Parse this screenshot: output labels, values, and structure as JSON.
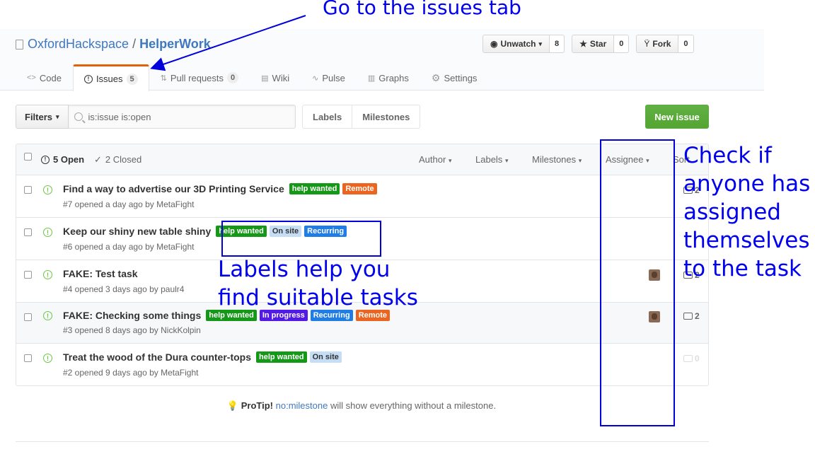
{
  "annotations": {
    "issues_tab": "Go to the issues tab",
    "labels_line1": "Labels help you",
    "labels_line2": "find suitable tasks",
    "assignee_line1": "Check if",
    "assignee_line2": "anyone has",
    "assignee_line3": "assigned",
    "assignee_line4": "themselves",
    "assignee_line5": "to the task"
  },
  "repo": {
    "owner": "OxfordHackspace",
    "separator": "/",
    "name": "HelperWork"
  },
  "actions": {
    "unwatch_label": "Unwatch",
    "unwatch_count": "8",
    "star_label": "Star",
    "star_count": "0",
    "fork_label": "Fork",
    "fork_count": "0"
  },
  "nav": {
    "code": "Code",
    "issues": "Issues",
    "issues_count": "5",
    "pulls": "Pull requests",
    "pulls_count": "0",
    "wiki": "Wiki",
    "pulse": "Pulse",
    "graphs": "Graphs",
    "settings": "Settings"
  },
  "filters": {
    "button": "Filters",
    "query": "is:issue is:open"
  },
  "subnav": {
    "labels": "Labels",
    "milestones": "Milestones"
  },
  "new_issue": "New issue",
  "table_header": {
    "open": "5 Open",
    "closed": "2 Closed",
    "author": "Author",
    "labels": "Labels",
    "milestones": "Milestones",
    "assignee": "Assignee",
    "sort": "Sort"
  },
  "issues": [
    {
      "title": "Find a way to advertise our 3D Printing Service",
      "meta": "#7 opened a day ago by MetaFight",
      "labels": [
        "help wanted",
        "Remote"
      ],
      "comments": "2"
    },
    {
      "title": "Keep our shiny new table shiny",
      "meta": "#6 opened a day ago by MetaFight",
      "labels": [
        "help wanted",
        "On site",
        "Recurring"
      ],
      "comments": ""
    },
    {
      "title": "FAKE: Test task",
      "meta": "#4 opened 3 days ago by paulr4",
      "labels": [],
      "comments": "2"
    },
    {
      "title": "FAKE: Checking some things",
      "meta": "#3 opened 8 days ago by NickKolpin",
      "labels": [
        "help wanted",
        "In progress",
        "Recurring",
        "Remote"
      ],
      "comments": "2"
    },
    {
      "title": "Treat the wood of the Dura counter-tops",
      "meta": "#2 opened 9 days ago by MetaFight",
      "labels": [
        "help wanted",
        "On site"
      ],
      "comments": "0"
    }
  ],
  "label_colors": {
    "help wanted": "#159818",
    "Remote": "#eb6420",
    "On site": "#c5def5",
    "Recurring": "#207de5",
    "In progress": "#5319e7"
  },
  "protip": {
    "lead": "ProTip!",
    "link": "no:milestone",
    "rest": " will show everything without a milestone."
  }
}
